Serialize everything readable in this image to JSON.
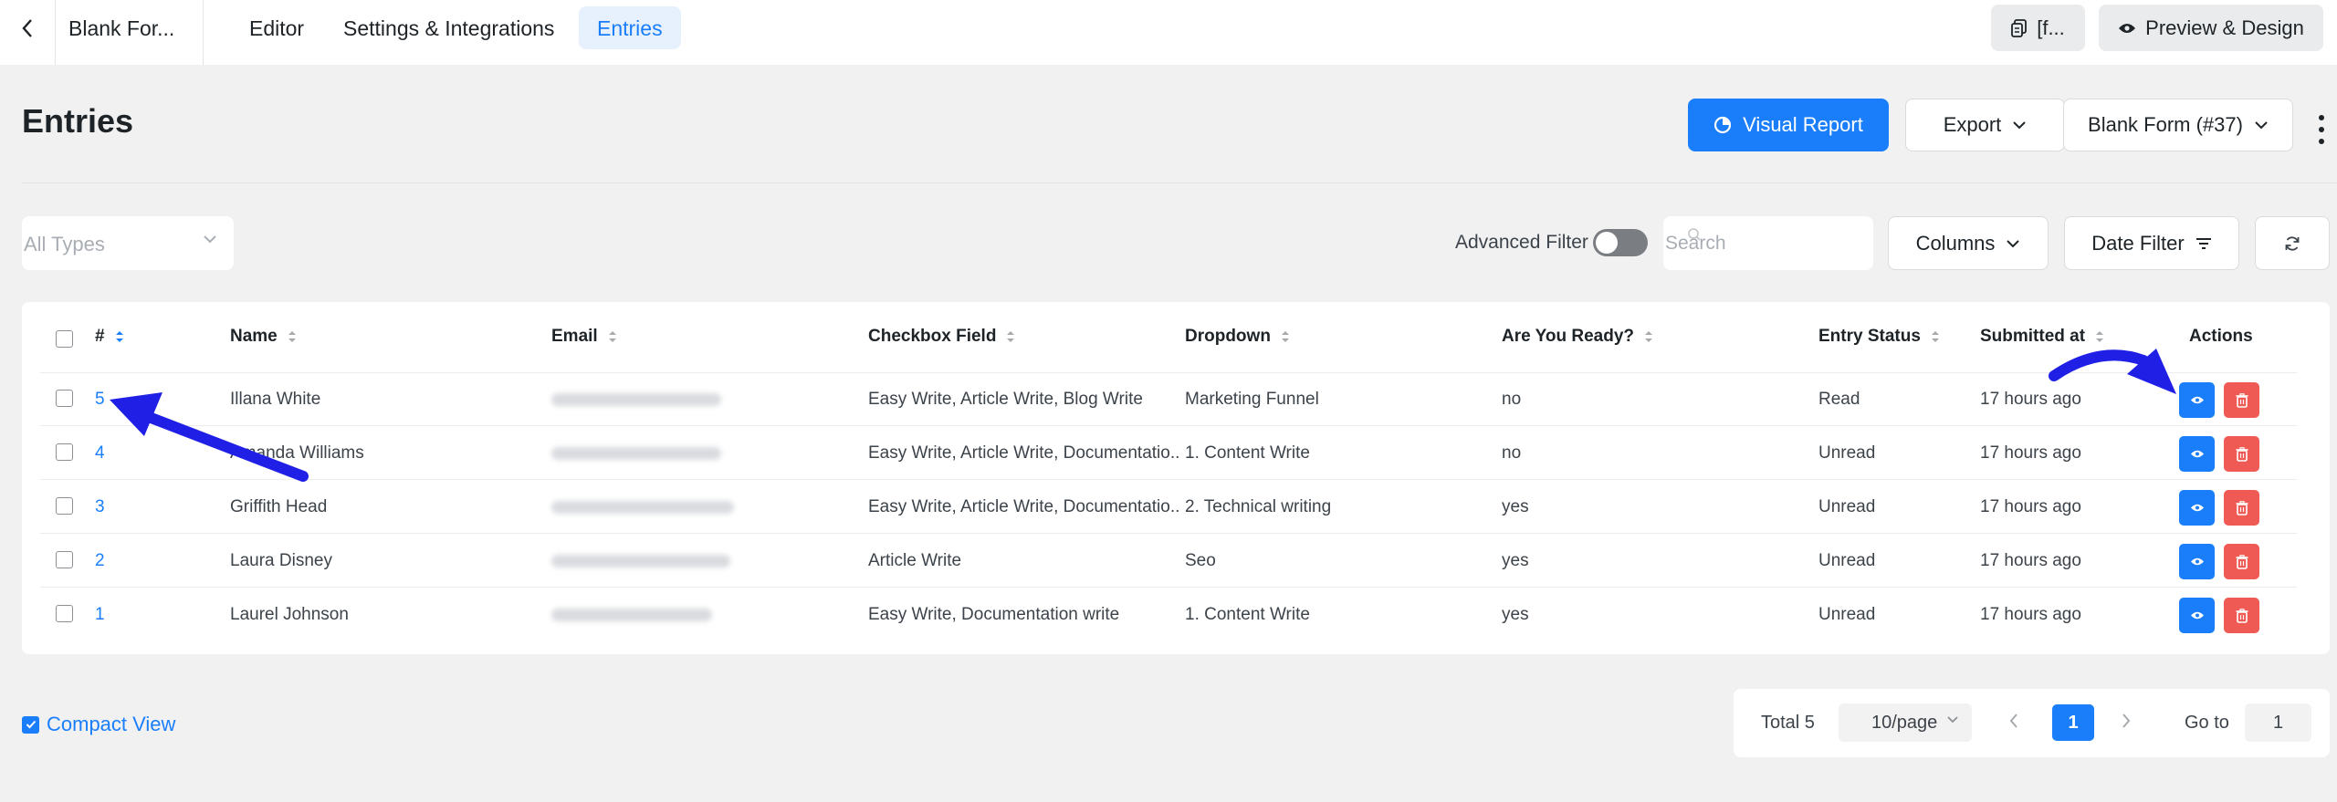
{
  "topbar": {
    "form_name": "Blank For...",
    "tabs": [
      {
        "label": "Editor"
      },
      {
        "label": "Settings & Integrations"
      },
      {
        "label": "Entries"
      }
    ],
    "shortcode_label": "[f...",
    "preview_label": "Preview & Design"
  },
  "header": {
    "title": "Entries",
    "visual_report_label": "Visual Report",
    "export_label": "Export",
    "form_selector_label": "Blank Form (#37)"
  },
  "filters": {
    "type_placeholder": "All Types",
    "advanced_filter_label": "Advanced Filter",
    "advanced_filter_on": false,
    "search_placeholder": "Search",
    "columns_label": "Columns",
    "date_filter_label": "Date Filter"
  },
  "table": {
    "columns": [
      "#",
      "Name",
      "Email",
      "Checkbox Field",
      "Dropdown",
      "Are You Ready?",
      "Entry Status",
      "Submitted at",
      "Actions"
    ],
    "rows": [
      {
        "id": "5",
        "name": "Illana White",
        "checkbox": "Easy Write, Article Write, Blog Write",
        "dropdown": "Marketing Funnel",
        "ready": "no",
        "status": "Read",
        "submitted": "17 hours ago"
      },
      {
        "id": "4",
        "name": "Amanda Williams",
        "checkbox": "Easy Write, Article Write, Documentatio...",
        "dropdown": "1. Content Write",
        "ready": "no",
        "status": "Unread",
        "submitted": "17 hours ago"
      },
      {
        "id": "3",
        "name": "Griffith Head",
        "checkbox": "Easy Write, Article Write, Documentatio...",
        "dropdown": "2. Technical writing",
        "ready": "yes",
        "status": "Unread",
        "submitted": "17 hours ago"
      },
      {
        "id": "2",
        "name": "Laura Disney",
        "checkbox": "Article Write",
        "dropdown": "Seo",
        "ready": "yes",
        "status": "Unread",
        "submitted": "17 hours ago"
      },
      {
        "id": "1",
        "name": "Laurel Johnson",
        "checkbox": "Easy Write, Documentation write",
        "dropdown": "1. Content Write",
        "ready": "yes",
        "status": "Unread",
        "submitted": "17 hours ago"
      }
    ]
  },
  "footer": {
    "compact_view_label": "Compact View",
    "compact_view_checked": true,
    "total_label": "Total 5",
    "page_size_label": "10/page",
    "current_page": "1",
    "goto_label": "Go to",
    "goto_value": "1"
  },
  "colors": {
    "accent": "#1a7efb",
    "danger": "#f05a54",
    "annotation": "#1f1fe6"
  }
}
